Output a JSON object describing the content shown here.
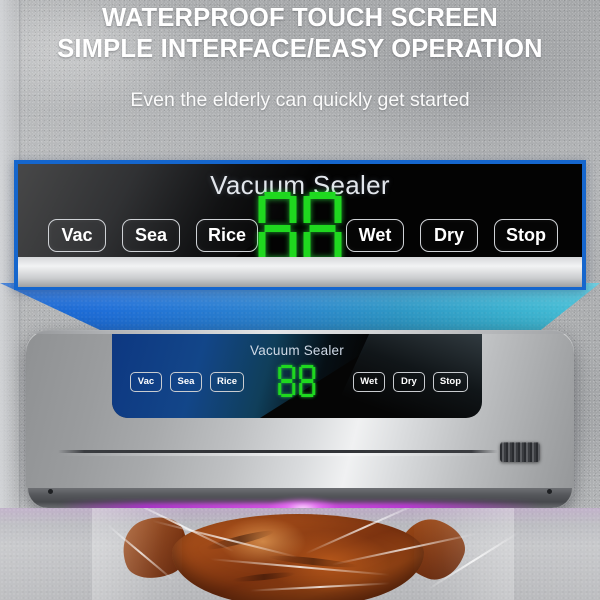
{
  "headline": {
    "line1": "WATERPROOF TOUCH SCREEN",
    "line2": "SIMPLE INTERFACE/EASY OPERATION",
    "subtitle": "Even the elderly can quickly get started"
  },
  "callout": {
    "panel_title": "Vacuum Sealer",
    "left_buttons": [
      "Vac",
      "Sea",
      "Rice"
    ],
    "right_buttons": [
      "Wet",
      "Dry",
      "Stop"
    ],
    "display_value": "88",
    "display_color": "#1fd81f",
    "border_color": "#1566cd"
  },
  "device": {
    "panel_title": "Vacuum Sealer",
    "left_buttons": [
      "Vac",
      "Sea",
      "Rice"
    ],
    "right_buttons": [
      "Wet",
      "Dry",
      "Stop"
    ],
    "display_value": "88"
  },
  "colors": {
    "background": "#b2b4b6",
    "beam_blue": "#1f6fd8",
    "beam_cyan": "#49c2d8",
    "seal_glow": "#e04ff0",
    "panel_black": "#050505",
    "body_silver": "#d9dbdd"
  }
}
